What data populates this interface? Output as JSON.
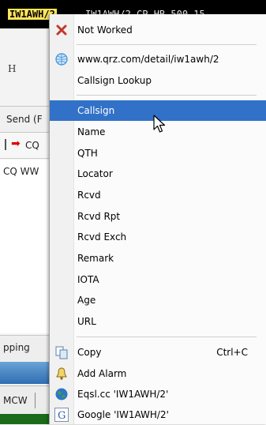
{
  "background": {
    "topbar": {
      "callsign": "IW1AWH/2",
      "spot_text": "IW1AWH/2 CP HB 500 15"
    },
    "h_label": "H",
    "send_label": "Send (F",
    "cq_label": "CQ",
    "cq_ww_label": "CQ WW",
    "stop_label": "pping",
    "mode_label": "MCW"
  },
  "menu": {
    "not_worked": "Not Worked",
    "url": "www.qrz.com/detail/iw1awh/2",
    "callsign_lookup": "Callsign Lookup",
    "fields": [
      "Callsign",
      "Name",
      "QTH",
      "Locator",
      "Rcvd",
      "Rcvd Rpt",
      "Rcvd Exch",
      "Remark",
      "IOTA",
      "Age",
      "URL"
    ],
    "copy": "Copy",
    "copy_shortcut": "Ctrl+C",
    "add_alarm": "Add Alarm",
    "eqsl": "Eqsl.cc 'IW1AWH/2'",
    "google": "Google 'IW1AWH/2'",
    "highlighted_item": "Callsign"
  },
  "colors": {
    "highlight": "#3271c8",
    "callsign_bg": "#ffe65a",
    "bottom_bar": "#1b6b1b"
  }
}
